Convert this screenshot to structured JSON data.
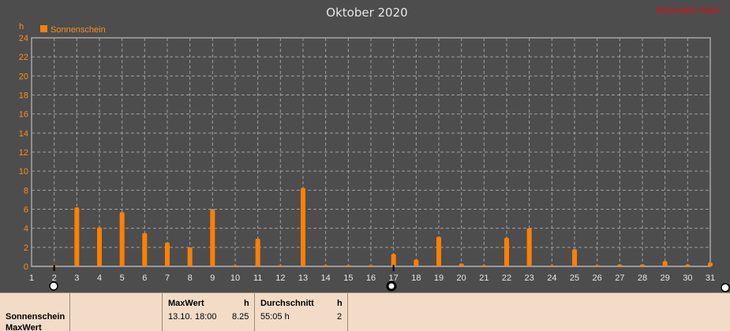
{
  "chart_data": {
    "type": "bar",
    "title": "Oktober 2020",
    "unit": "h",
    "watermark_text": "Wetterstation Hatten",
    "legend": "Sonnenschein",
    "ylim": [
      0,
      24
    ],
    "yticks": [
      0,
      2,
      4,
      6,
      8,
      10,
      12,
      14,
      16,
      18,
      20,
      22,
      24
    ],
    "grid": true,
    "categories": [
      "1",
      "2",
      "3",
      "4",
      "5",
      "6",
      "7",
      "8",
      "9",
      "10",
      "11",
      "12",
      "13",
      "14",
      "15",
      "16",
      "17",
      "18",
      "19",
      "20",
      "21",
      "22",
      "23",
      "24",
      "25",
      "26",
      "27",
      "28",
      "29",
      "30",
      "31"
    ],
    "series": [
      {
        "name": "Sonnenschein",
        "values": [
          0,
          0.1,
          6.2,
          4.1,
          5.7,
          3.5,
          2.5,
          2.0,
          6.0,
          0.1,
          2.9,
          0.05,
          8.25,
          0.05,
          0.05,
          0.1,
          1.3,
          0.7,
          3.1,
          0.3,
          0.1,
          3.0,
          4.0,
          0.05,
          1.8,
          0.1,
          0.2,
          0.2,
          0.55,
          0.2,
          0.4
        ],
        "color": "#ff8000"
      }
    ],
    "cursor_days": [
      "2",
      "17"
    ]
  },
  "colors": {
    "background": "#4d4d4d",
    "series": "#ff8000",
    "axis_text": "#ff8c1a",
    "watermark": "#ff0000",
    "title": "#e6e6e6",
    "panel": "#f2dcc8"
  },
  "summary": {
    "row_labels": [
      "Sonnenschein",
      "MaxWert"
    ],
    "maxwert": {
      "header": "MaxWert",
      "unit": "h",
      "date": "13.10.",
      "time": "18:00",
      "value": "8.25"
    },
    "durchschnitt": {
      "header": "Durchschnitt",
      "unit": "h",
      "value": "55:05 h",
      "count": "2"
    }
  }
}
